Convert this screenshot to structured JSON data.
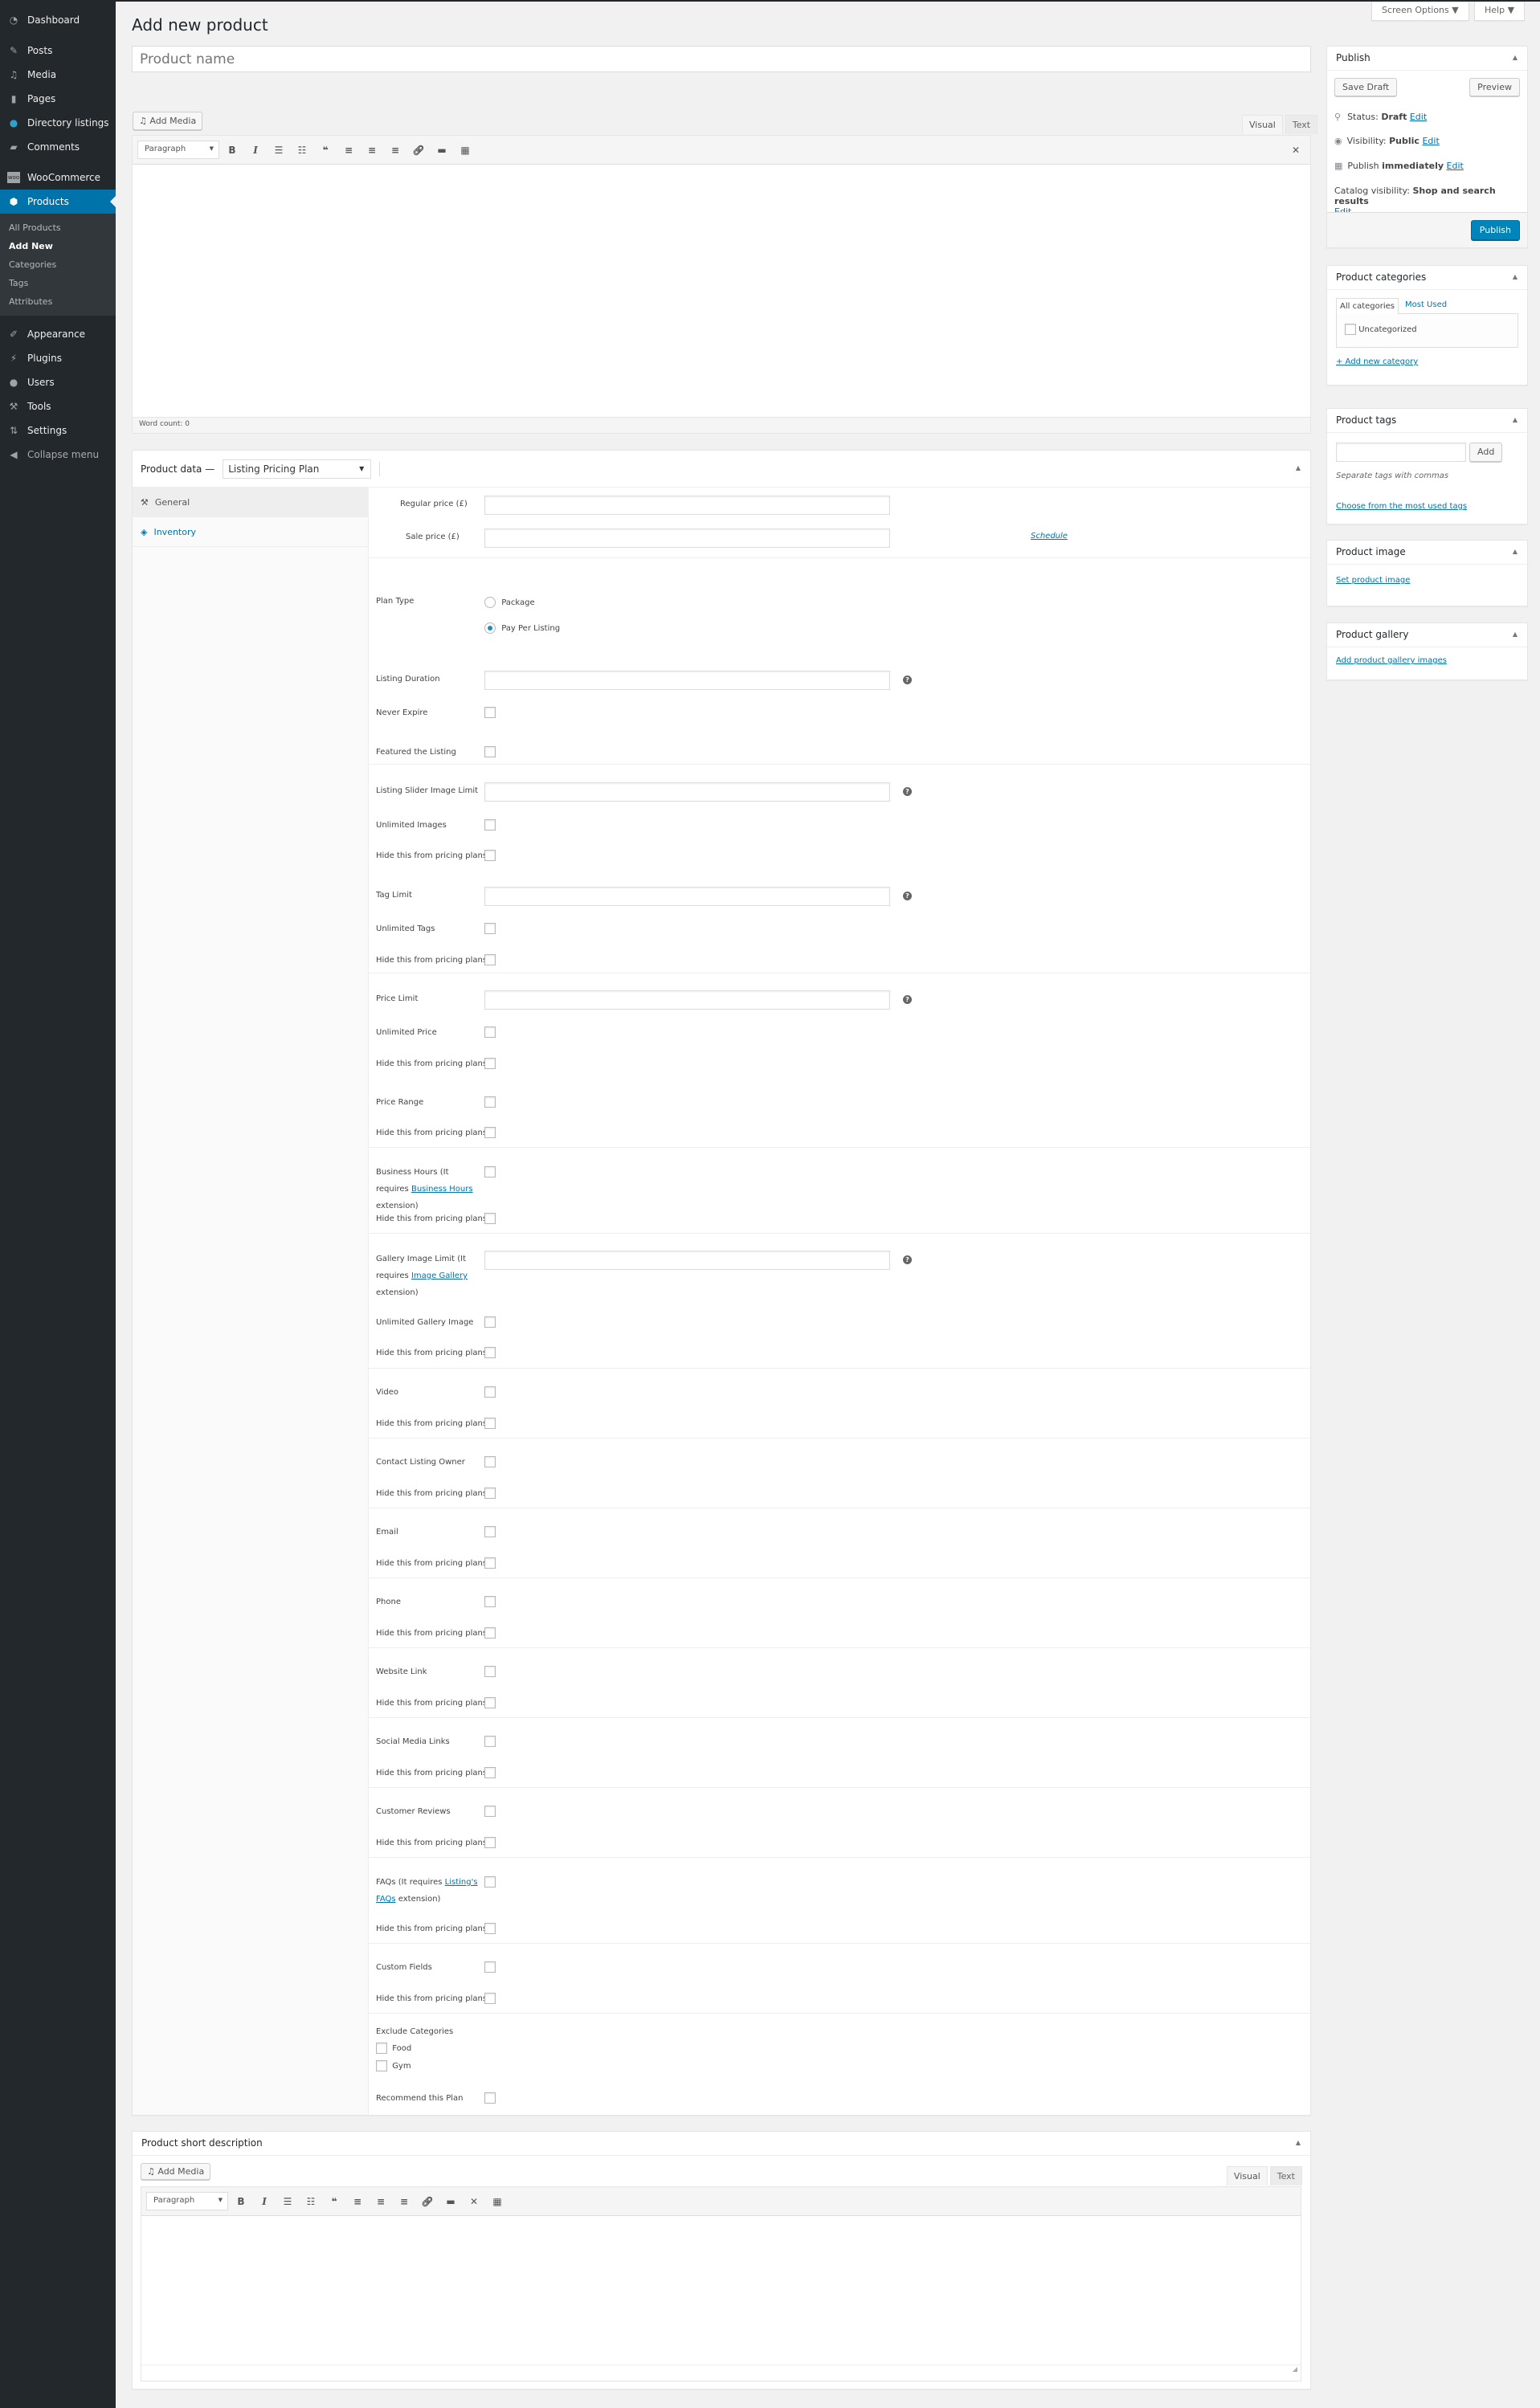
{
  "sidebar": {
    "items": [
      {
        "label": "Dashboard",
        "icon": "dashboard-icon"
      },
      {
        "label": "Posts",
        "icon": "pin-icon"
      },
      {
        "label": "Media",
        "icon": "media-icon"
      },
      {
        "label": "Pages",
        "icon": "pages-icon"
      },
      {
        "label": "Directory listings",
        "icon": "location-icon"
      },
      {
        "label": "Comments",
        "icon": "comment-icon"
      },
      {
        "label": "WooCommerce",
        "icon": "woo-icon"
      },
      {
        "label": "Products",
        "icon": "box-icon"
      },
      {
        "label": "Appearance",
        "icon": "brush-icon"
      },
      {
        "label": "Plugins",
        "icon": "plugin-icon"
      },
      {
        "label": "Users",
        "icon": "user-icon"
      },
      {
        "label": "Tools",
        "icon": "wrench-icon"
      },
      {
        "label": "Settings",
        "icon": "settings-icon"
      }
    ],
    "submenu": [
      "All Products",
      "Add New",
      "Categories",
      "Tags",
      "Attributes"
    ],
    "collapse": "Collapse menu"
  },
  "header": {
    "screen_options": "Screen Options ▼",
    "help": "Help ▼",
    "title": "Add new product"
  },
  "product_name_placeholder": "Product name",
  "editor": {
    "add_media": "Add Media",
    "format": "Paragraph",
    "tab_visual": "Visual",
    "tab_text": "Text",
    "word_count": "Word count: 0"
  },
  "publish": {
    "title": "Publish",
    "save_draft": "Save Draft",
    "preview": "Preview",
    "status_label": "Status:",
    "status_value": "Draft",
    "visibility_label": "Visibility:",
    "visibility_value": "Public",
    "publish_label": "Publish",
    "publish_value": "immediately",
    "catalog_label": "Catalog visibility:",
    "catalog_value": "Shop and search results",
    "edit": "Edit",
    "publish_button": "Publish"
  },
  "categories": {
    "title": "Product categories",
    "tab_all": "All categories",
    "tab_most": "Most Used",
    "items": [
      "Uncategorized"
    ],
    "add_new": "+ Add new category"
  },
  "tags": {
    "title": "Product tags",
    "add": "Add",
    "hint": "Separate tags with commas",
    "choose": "Choose from the most used tags"
  },
  "image": {
    "title": "Product image",
    "link": "Set product image"
  },
  "gallery": {
    "title": "Product gallery",
    "link": "Add product gallery images"
  },
  "product_data": {
    "title": "Product data —",
    "type": "Listing Pricing Plan",
    "tabs": [
      {
        "label": "General",
        "icon": "wrench-icon"
      },
      {
        "label": "Inventory",
        "icon": "tag-icon"
      }
    ],
    "regular_price": "Regular price (£)",
    "sale_price": "Sale price (£)",
    "schedule": "Schedule",
    "plan_type": "Plan Type",
    "plan_options": [
      "Package",
      "Pay Per Listing"
    ],
    "plan_selected": "Pay Per Listing",
    "hide": "Hide this from pricing plans",
    "fields": {
      "listing_duration": "Listing Duration",
      "never_expire": "Never Expire",
      "featured": "Featured the Listing",
      "slider_limit": "Listing Slider Image Limit",
      "unlimited_images": "Unlimited Images",
      "tag_limit": "Tag Limit",
      "unlimited_tags": "Unlimited Tags",
      "price_limit": "Price Limit",
      "unlimited_price": "Unlimited Price",
      "price_range": "Price Range",
      "business_hours_pre": "Business Hours (It requires",
      "business_hours_link": "Business Hours",
      "business_hours_post": "extension)",
      "gallery_pre": "Gallery Image Limit (It requires",
      "gallery_link": "Image Gallery",
      "gallery_post": "extension)",
      "unlimited_gallery": "Unlimited Gallery Image",
      "video": "Video",
      "contact": "Contact Listing Owner",
      "email": "Email",
      "phone": "Phone",
      "website": "Website Link",
      "social": "Social Media Links",
      "reviews": "Customer Reviews",
      "faqs_pre": "FAQs (It requires",
      "faqs_link": "Listing's FAQs",
      "faqs_post": "extension)",
      "custom_fields": "Custom Fields",
      "exclude": "Exclude Categories",
      "exclude_items": [
        "Food",
        "Gym"
      ],
      "recommend": "Recommend this Plan"
    }
  },
  "short_desc": {
    "title": "Product short description",
    "add_media": "Add Media",
    "format": "Paragraph",
    "tab_visual": "Visual",
    "tab_text": "Text"
  }
}
